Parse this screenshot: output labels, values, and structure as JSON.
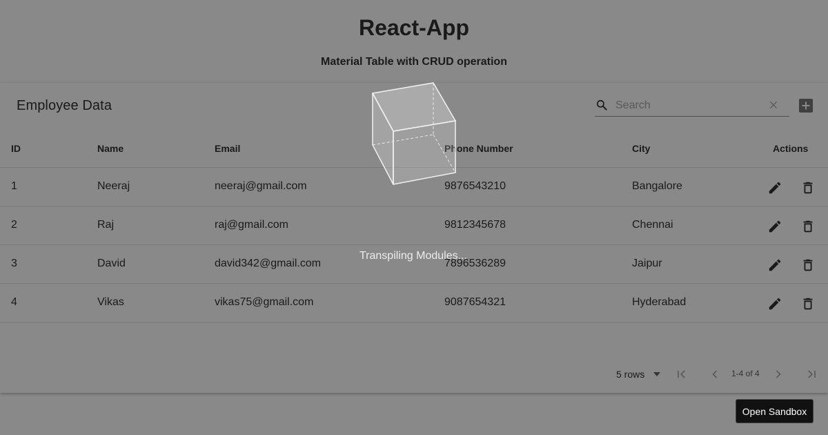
{
  "app": {
    "title": "React-App",
    "subtitle": "Material Table with CRUD operation"
  },
  "table": {
    "title": "Employee Data",
    "search_placeholder": "Search",
    "columns": [
      "ID",
      "Name",
      "Email",
      "Phone Number",
      "City",
      "Actions"
    ],
    "rows": [
      {
        "id": "1",
        "name": "Neeraj",
        "email": "neeraj@gmail.com",
        "phone": "9876543210",
        "city": "Bangalore"
      },
      {
        "id": "2",
        "name": "Raj",
        "email": "raj@gmail.com",
        "phone": "9812345678",
        "city": "Chennai"
      },
      {
        "id": "3",
        "name": "David",
        "email": "david342@gmail.com",
        "phone": "7896536289",
        "city": "Jaipur"
      },
      {
        "id": "4",
        "name": "Vikas",
        "email": "vikas75@gmail.com",
        "phone": "9087654321",
        "city": "Hyderabad"
      }
    ],
    "pagination": {
      "rows_per_page": "5 rows",
      "range": "1-4 of 4"
    }
  },
  "overlay": {
    "loading_text": "Transpiling Modules..."
  },
  "sandbox": {
    "button_label": "Open Sandbox"
  },
  "icons": {
    "search": "search-icon",
    "clear": "close-icon",
    "add": "add-box-icon",
    "edit": "pencil-icon",
    "delete": "trash-icon",
    "first_page": "first-page-icon",
    "prev_page": "chevron-left-icon",
    "next_page": "chevron-right-icon",
    "last_page": "last-page-icon"
  },
  "colors": {
    "overlay": "#141414",
    "text": "#212121"
  }
}
